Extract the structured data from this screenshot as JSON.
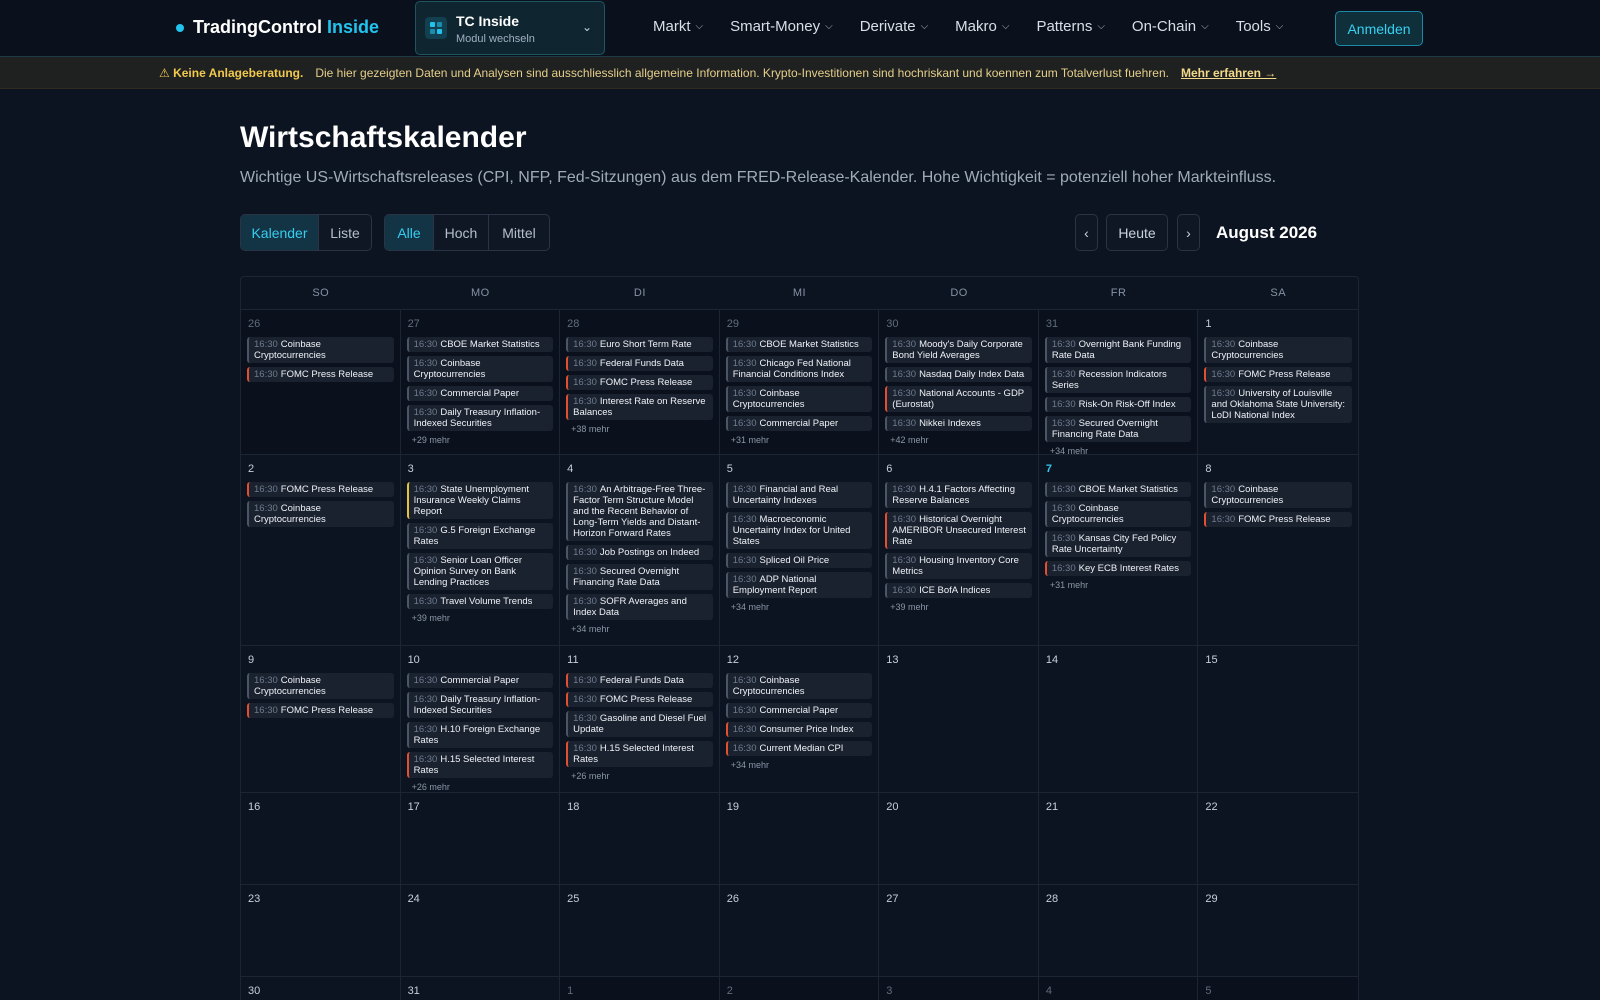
{
  "brand": {
    "name": "TradingControl",
    "accent": "Inside"
  },
  "module": {
    "title": "TC Inside",
    "subtitle": "Modul wechseln"
  },
  "nav": [
    "Markt",
    "Smart-Money",
    "Derivate",
    "Makro",
    "Patterns",
    "On-Chain",
    "Tools"
  ],
  "login_label": "Anmelden",
  "disclaimer": {
    "warning": "⚠ Keine Anlageberatung.",
    "text": "Die hier gezeigten Daten und Analysen sind ausschliesslich allgemeine Information. Krypto-Investitionen sind hochriskant und koennen zum Totalverlust fuehren.",
    "link": "Mehr erfahren →"
  },
  "page": {
    "title": "Wirtschaftskalender",
    "subtitle": "Wichtige US-Wirtschaftsreleases (CPI, NFP, Fed-Sitzungen) aus dem FRED-Release-Kalender. Hohe Wichtigkeit = potenziell hoher Markteinfluss."
  },
  "view_toggle": {
    "calendar": "Kalender",
    "list": "Liste"
  },
  "filter_toggle": {
    "all": "Alle",
    "high": "Hoch",
    "medium": "Mittel"
  },
  "month_nav": {
    "prev": "‹",
    "today": "Heute",
    "next": "›",
    "label": "August 2026"
  },
  "weekdays": [
    "SO",
    "MO",
    "DI",
    "MI",
    "DO",
    "FR",
    "SA"
  ],
  "colors": {
    "accent": "#22c3ee",
    "high": "#e3502f",
    "medium": "#e6c43a",
    "normal": "#4a5566"
  },
  "weeks": [
    {
      "height": 145,
      "days": [
        {
          "d": "26",
          "out": true,
          "events": [
            {
              "t": "16:30",
              "n": "Coinbase Cryptocurrencies",
              "imp": "normal"
            },
            {
              "t": "16:30",
              "n": "FOMC Press Release",
              "imp": "hi"
            }
          ]
        },
        {
          "d": "27",
          "out": true,
          "events": [
            {
              "t": "16:30",
              "n": "CBOE Market Statistics",
              "imp": "normal"
            },
            {
              "t": "16:30",
              "n": "Coinbase Cryptocurrencies",
              "imp": "normal"
            },
            {
              "t": "16:30",
              "n": "Commercial Paper",
              "imp": "normal"
            },
            {
              "t": "16:30",
              "n": "Daily Treasury Inflation-Indexed Securities",
              "imp": "normal"
            }
          ],
          "more": "+29 mehr"
        },
        {
          "d": "28",
          "out": true,
          "events": [
            {
              "t": "16:30",
              "n": "Euro Short Term Rate",
              "imp": "normal"
            },
            {
              "t": "16:30",
              "n": "Federal Funds Data",
              "imp": "hi"
            },
            {
              "t": "16:30",
              "n": "FOMC Press Release",
              "imp": "hi"
            },
            {
              "t": "16:30",
              "n": "Interest Rate on Reserve Balances",
              "imp": "hi"
            }
          ],
          "more": "+38 mehr"
        },
        {
          "d": "29",
          "out": true,
          "events": [
            {
              "t": "16:30",
              "n": "CBOE Market Statistics",
              "imp": "normal"
            },
            {
              "t": "16:30",
              "n": "Chicago Fed National Financial Conditions Index",
              "imp": "normal"
            },
            {
              "t": "16:30",
              "n": "Coinbase Cryptocurrencies",
              "imp": "normal"
            },
            {
              "t": "16:30",
              "n": "Commercial Paper",
              "imp": "normal"
            }
          ],
          "more": "+31 mehr"
        },
        {
          "d": "30",
          "out": true,
          "events": [
            {
              "t": "16:30",
              "n": "Moody's Daily Corporate Bond Yield Averages",
              "imp": "normal"
            },
            {
              "t": "16:30",
              "n": "Nasdaq Daily Index Data",
              "imp": "normal"
            },
            {
              "t": "16:30",
              "n": "National Accounts - GDP (Eurostat)",
              "imp": "hi"
            },
            {
              "t": "16:30",
              "n": "Nikkei Indexes",
              "imp": "normal"
            }
          ],
          "more": "+42 mehr"
        },
        {
          "d": "31",
          "out": true,
          "events": [
            {
              "t": "16:30",
              "n": "Overnight Bank Funding Rate Data",
              "imp": "normal"
            },
            {
              "t": "16:30",
              "n": "Recession Indicators Series",
              "imp": "normal"
            },
            {
              "t": "16:30",
              "n": "Risk-On Risk-Off Index",
              "imp": "normal"
            },
            {
              "t": "16:30",
              "n": "Secured Overnight Financing Rate Data",
              "imp": "normal"
            }
          ],
          "more": "+34 mehr"
        },
        {
          "d": "1",
          "out": false,
          "events": [
            {
              "t": "16:30",
              "n": "Coinbase Cryptocurrencies",
              "imp": "normal"
            },
            {
              "t": "16:30",
              "n": "FOMC Press Release",
              "imp": "hi"
            },
            {
              "t": "16:30",
              "n": "University of Louisville and Oklahoma State University: LoDI National Index",
              "imp": "normal"
            }
          ]
        }
      ]
    },
    {
      "height": 191,
      "days": [
        {
          "d": "2",
          "events": [
            {
              "t": "16:30",
              "n": "FOMC Press Release",
              "imp": "hi"
            },
            {
              "t": "16:30",
              "n": "Coinbase Cryptocurrencies",
              "imp": "normal"
            }
          ]
        },
        {
          "d": "3",
          "events": [
            {
              "t": "16:30",
              "n": "State Unemployment Insurance Weekly Claims Report",
              "imp": "med"
            },
            {
              "t": "16:30",
              "n": "G.5 Foreign Exchange Rates",
              "imp": "normal"
            },
            {
              "t": "16:30",
              "n": "Senior Loan Officer Opinion Survey on Bank Lending Practices",
              "imp": "normal"
            },
            {
              "t": "16:30",
              "n": "Travel Volume Trends",
              "imp": "normal"
            }
          ],
          "more": "+39 mehr"
        },
        {
          "d": "4",
          "events": [
            {
              "t": "16:30",
              "n": "An Arbitrage-Free Three-Factor Term Structure Model and the Recent Behavior of Long-Term Yields and Distant-Horizon Forward Rates",
              "imp": "normal"
            },
            {
              "t": "16:30",
              "n": "Job Postings on Indeed",
              "imp": "normal"
            },
            {
              "t": "16:30",
              "n": "Secured Overnight Financing Rate Data",
              "imp": "normal"
            },
            {
              "t": "16:30",
              "n": "SOFR Averages and Index Data",
              "imp": "normal"
            }
          ],
          "more": "+34 mehr"
        },
        {
          "d": "5",
          "events": [
            {
              "t": "16:30",
              "n": "Financial and Real Uncertainty Indexes",
              "imp": "normal"
            },
            {
              "t": "16:30",
              "n": "Macroeconomic Uncertainty Index for United States",
              "imp": "normal"
            },
            {
              "t": "16:30",
              "n": "Spliced Oil Price",
              "imp": "normal"
            },
            {
              "t": "16:30",
              "n": "ADP National Employment Report",
              "imp": "normal"
            }
          ],
          "more": "+34 mehr"
        },
        {
          "d": "6",
          "events": [
            {
              "t": "16:30",
              "n": "H.4.1 Factors Affecting Reserve Balances",
              "imp": "normal"
            },
            {
              "t": "16:30",
              "n": "Historical Overnight AMERIBOR Unsecured Interest Rate",
              "imp": "hi"
            },
            {
              "t": "16:30",
              "n": "Housing Inventory Core Metrics",
              "imp": "normal"
            },
            {
              "t": "16:30",
              "n": "ICE BofA Indices",
              "imp": "normal"
            }
          ],
          "more": "+39 mehr"
        },
        {
          "d": "7",
          "today": true,
          "events": [
            {
              "t": "16:30",
              "n": "CBOE Market Statistics",
              "imp": "normal"
            },
            {
              "t": "16:30",
              "n": "Coinbase Cryptocurrencies",
              "imp": "normal"
            },
            {
              "t": "16:30",
              "n": "Kansas City Fed Policy Rate Uncertainty",
              "imp": "normal"
            },
            {
              "t": "16:30",
              "n": "Key ECB Interest Rates",
              "imp": "hi"
            }
          ],
          "more": "+31 mehr"
        },
        {
          "d": "8",
          "events": [
            {
              "t": "16:30",
              "n": "Coinbase Cryptocurrencies",
              "imp": "normal"
            },
            {
              "t": "16:30",
              "n": "FOMC Press Release",
              "imp": "hi"
            }
          ]
        }
      ]
    },
    {
      "height": 147,
      "days": [
        {
          "d": "9",
          "events": [
            {
              "t": "16:30",
              "n": "Coinbase Cryptocurrencies",
              "imp": "normal"
            },
            {
              "t": "16:30",
              "n": "FOMC Press Release",
              "imp": "hi"
            }
          ]
        },
        {
          "d": "10",
          "events": [
            {
              "t": "16:30",
              "n": "Commercial Paper",
              "imp": "normal"
            },
            {
              "t": "16:30",
              "n": "Daily Treasury Inflation-Indexed Securities",
              "imp": "normal"
            },
            {
              "t": "16:30",
              "n": "H.10 Foreign Exchange Rates",
              "imp": "normal"
            },
            {
              "t": "16:30",
              "n": "H.15 Selected Interest Rates",
              "imp": "hi"
            }
          ],
          "more": "+26 mehr"
        },
        {
          "d": "11",
          "events": [
            {
              "t": "16:30",
              "n": "Federal Funds Data",
              "imp": "hi"
            },
            {
              "t": "16:30",
              "n": "FOMC Press Release",
              "imp": "hi"
            },
            {
              "t": "16:30",
              "n": "Gasoline and Diesel Fuel Update",
              "imp": "normal"
            },
            {
              "t": "16:30",
              "n": "H.15 Selected Interest Rates",
              "imp": "hi"
            }
          ],
          "more": "+26 mehr"
        },
        {
          "d": "12",
          "events": [
            {
              "t": "16:30",
              "n": "Coinbase Cryptocurrencies",
              "imp": "normal"
            },
            {
              "t": "16:30",
              "n": "Commercial Paper",
              "imp": "normal"
            },
            {
              "t": "16:30",
              "n": "Consumer Price Index",
              "imp": "hi"
            },
            {
              "t": "16:30",
              "n": "Current Median CPI",
              "imp": "hi"
            }
          ],
          "more": "+34 mehr"
        },
        {
          "d": "13",
          "events": []
        },
        {
          "d": "14",
          "events": []
        },
        {
          "d": "15",
          "events": []
        }
      ]
    },
    {
      "height": 92,
      "days": [
        {
          "d": "16",
          "events": []
        },
        {
          "d": "17",
          "events": []
        },
        {
          "d": "18",
          "events": []
        },
        {
          "d": "19",
          "events": []
        },
        {
          "d": "20",
          "events": []
        },
        {
          "d": "21",
          "events": []
        },
        {
          "d": "22",
          "events": []
        }
      ]
    },
    {
      "height": 92,
      "days": [
        {
          "d": "23",
          "events": []
        },
        {
          "d": "24",
          "events": []
        },
        {
          "d": "25",
          "events": []
        },
        {
          "d": "26",
          "events": []
        },
        {
          "d": "27",
          "events": []
        },
        {
          "d": "28",
          "events": []
        },
        {
          "d": "29",
          "events": []
        }
      ]
    },
    {
      "height": 40,
      "days": [
        {
          "d": "30",
          "events": []
        },
        {
          "d": "31",
          "events": []
        },
        {
          "d": "1",
          "out": true,
          "events": []
        },
        {
          "d": "2",
          "out": true,
          "events": []
        },
        {
          "d": "3",
          "out": true,
          "events": []
        },
        {
          "d": "4",
          "out": true,
          "events": []
        },
        {
          "d": "5",
          "out": true,
          "events": []
        }
      ]
    }
  ]
}
